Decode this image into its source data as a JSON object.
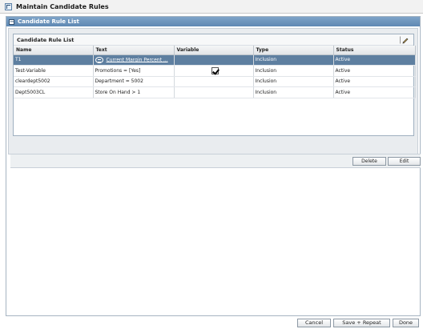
{
  "window": {
    "title": "Maintain Candidate Rules"
  },
  "section": {
    "title": "Candidate Rule List"
  },
  "rule_box": {
    "title": "Candidate Rule List"
  },
  "table": {
    "columns": [
      "Name",
      "Text",
      "Variable",
      "Type",
      "Status"
    ],
    "rows": [
      {
        "name": "T1",
        "text": "Current Margin Percent ...",
        "variable": "",
        "type": "Inclusion",
        "status": "Active"
      },
      {
        "name": "Test-Variable",
        "text": "Promotions = [Yes]",
        "variable": "checked",
        "type": "Inclusion",
        "status": "Active"
      },
      {
        "name": "cleardept5002",
        "text": "Department = 5002",
        "variable": "",
        "type": "Inclusion",
        "status": "Active"
      },
      {
        "name": "Dept5003CL",
        "text": "Store On Hand > 1",
        "variable": "",
        "type": "Inclusion",
        "status": "Active"
      }
    ]
  },
  "actions": {
    "delete_label": "Delete",
    "edit_label": "Edit"
  },
  "footer": {
    "cancel_label": "Cancel",
    "save_repeat_label": "Save + Repeat",
    "done_label": "Done"
  },
  "icons": {
    "window": "app-window-icon",
    "collapse": "minus-icon",
    "edit": "pencil-icon",
    "condition": "condition-icon",
    "check": "checkmark-icon"
  },
  "colors": {
    "header_blue": "#6a93bb",
    "selected_row": "#5e7fa0"
  }
}
